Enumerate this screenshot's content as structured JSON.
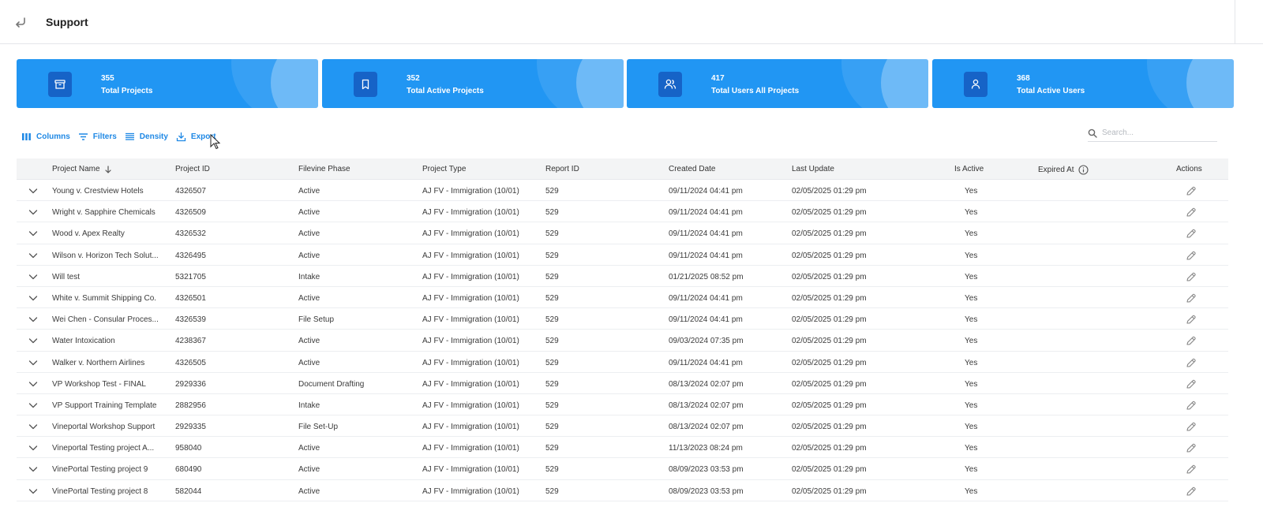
{
  "header": {
    "title": "Support"
  },
  "stats": [
    {
      "value": "355",
      "label": "Total Projects",
      "icon": "archive-icon"
    },
    {
      "value": "352",
      "label": "Total Active Projects",
      "icon": "bookmark-icon"
    },
    {
      "value": "417",
      "label": "Total Users All Projects",
      "icon": "users-icon"
    },
    {
      "value": "368",
      "label": "Total Active Users",
      "icon": "user-icon"
    }
  ],
  "toolbar": {
    "columns_label": "Columns",
    "filters_label": "Filters",
    "density_label": "Density",
    "export_label": "Export"
  },
  "search": {
    "placeholder": "Search..."
  },
  "table": {
    "headers": {
      "project_name": "Project Name",
      "project_id": "Project ID",
      "filevine_phase": "Filevine Phase",
      "project_type": "Project Type",
      "report_id": "Report ID",
      "created_date": "Created Date",
      "last_update": "Last Update",
      "is_active": "Is Active",
      "expired_at": "Expired At",
      "actions": "Actions"
    },
    "rows": [
      {
        "name": "Young v. Crestview Hotels",
        "pid": "4326507",
        "phase": "Active",
        "type": "AJ FV - Immigration (10/01)",
        "rid": "529",
        "created": "09/11/2024 04:41 pm",
        "updated": "02/05/2025 01:29 pm",
        "active": "Yes"
      },
      {
        "name": "Wright v. Sapphire Chemicals",
        "pid": "4326509",
        "phase": "Active",
        "type": "AJ FV - Immigration (10/01)",
        "rid": "529",
        "created": "09/11/2024 04:41 pm",
        "updated": "02/05/2025 01:29 pm",
        "active": "Yes"
      },
      {
        "name": "Wood v. Apex Realty",
        "pid": "4326532",
        "phase": "Active",
        "type": "AJ FV - Immigration (10/01)",
        "rid": "529",
        "created": "09/11/2024 04:41 pm",
        "updated": "02/05/2025 01:29 pm",
        "active": "Yes"
      },
      {
        "name": "Wilson v. Horizon Tech Solut...",
        "pid": "4326495",
        "phase": "Active",
        "type": "AJ FV - Immigration (10/01)",
        "rid": "529",
        "created": "09/11/2024 04:41 pm",
        "updated": "02/05/2025 01:29 pm",
        "active": "Yes"
      },
      {
        "name": "Will test",
        "pid": "5321705",
        "phase": "Intake",
        "type": "AJ FV - Immigration (10/01)",
        "rid": "529",
        "created": "01/21/2025 08:52 pm",
        "updated": "02/05/2025 01:29 pm",
        "active": "Yes"
      },
      {
        "name": "White v. Summit Shipping Co.",
        "pid": "4326501",
        "phase": "Active",
        "type": "AJ FV - Immigration (10/01)",
        "rid": "529",
        "created": "09/11/2024 04:41 pm",
        "updated": "02/05/2025 01:29 pm",
        "active": "Yes"
      },
      {
        "name": "Wei Chen - Consular Proces...",
        "pid": "4326539",
        "phase": "File Setup",
        "type": "AJ FV - Immigration (10/01)",
        "rid": "529",
        "created": "09/11/2024 04:41 pm",
        "updated": "02/05/2025 01:29 pm",
        "active": "Yes"
      },
      {
        "name": "Water Intoxication",
        "pid": "4238367",
        "phase": "Active",
        "type": "AJ FV - Immigration (10/01)",
        "rid": "529",
        "created": "09/03/2024 07:35 pm",
        "updated": "02/05/2025 01:29 pm",
        "active": "Yes"
      },
      {
        "name": "Walker v. Northern Airlines",
        "pid": "4326505",
        "phase": "Active",
        "type": "AJ FV - Immigration (10/01)",
        "rid": "529",
        "created": "09/11/2024 04:41 pm",
        "updated": "02/05/2025 01:29 pm",
        "active": "Yes"
      },
      {
        "name": "VP Workshop Test - FINAL",
        "pid": "2929336",
        "phase": "Document Drafting",
        "type": "AJ FV - Immigration (10/01)",
        "rid": "529",
        "created": "08/13/2024 02:07 pm",
        "updated": "02/05/2025 01:29 pm",
        "active": "Yes"
      },
      {
        "name": "VP Support Training Template",
        "pid": "2882956",
        "phase": "Intake",
        "type": "AJ FV - Immigration (10/01)",
        "rid": "529",
        "created": "08/13/2024 02:07 pm",
        "updated": "02/05/2025 01:29 pm",
        "active": "Yes"
      },
      {
        "name": "Vineportal Workshop Support",
        "pid": "2929335",
        "phase": "File Set-Up",
        "type": "AJ FV - Immigration (10/01)",
        "rid": "529",
        "created": "08/13/2024 02:07 pm",
        "updated": "02/05/2025 01:29 pm",
        "active": "Yes"
      },
      {
        "name": "Vineportal Testing project A...",
        "pid": "958040",
        "phase": "Active",
        "type": "AJ FV - Immigration (10/01)",
        "rid": "529",
        "created": "11/13/2023 08:24 pm",
        "updated": "02/05/2025 01:29 pm",
        "active": "Yes"
      },
      {
        "name": "VinePortal Testing project 9",
        "pid": "680490",
        "phase": "Active",
        "type": "AJ FV - Immigration (10/01)",
        "rid": "529",
        "created": "08/09/2023 03:53 pm",
        "updated": "02/05/2025 01:29 pm",
        "active": "Yes"
      },
      {
        "name": "VinePortal Testing project 8",
        "pid": "582044",
        "phase": "Active",
        "type": "AJ FV - Immigration (10/01)",
        "rid": "529",
        "created": "08/09/2023 03:53 pm",
        "updated": "02/05/2025 01:29 pm",
        "active": "Yes"
      }
    ]
  },
  "colors": {
    "accent": "#2196f3",
    "icon_box": "#1663c7",
    "link": "#1e88e5"
  }
}
